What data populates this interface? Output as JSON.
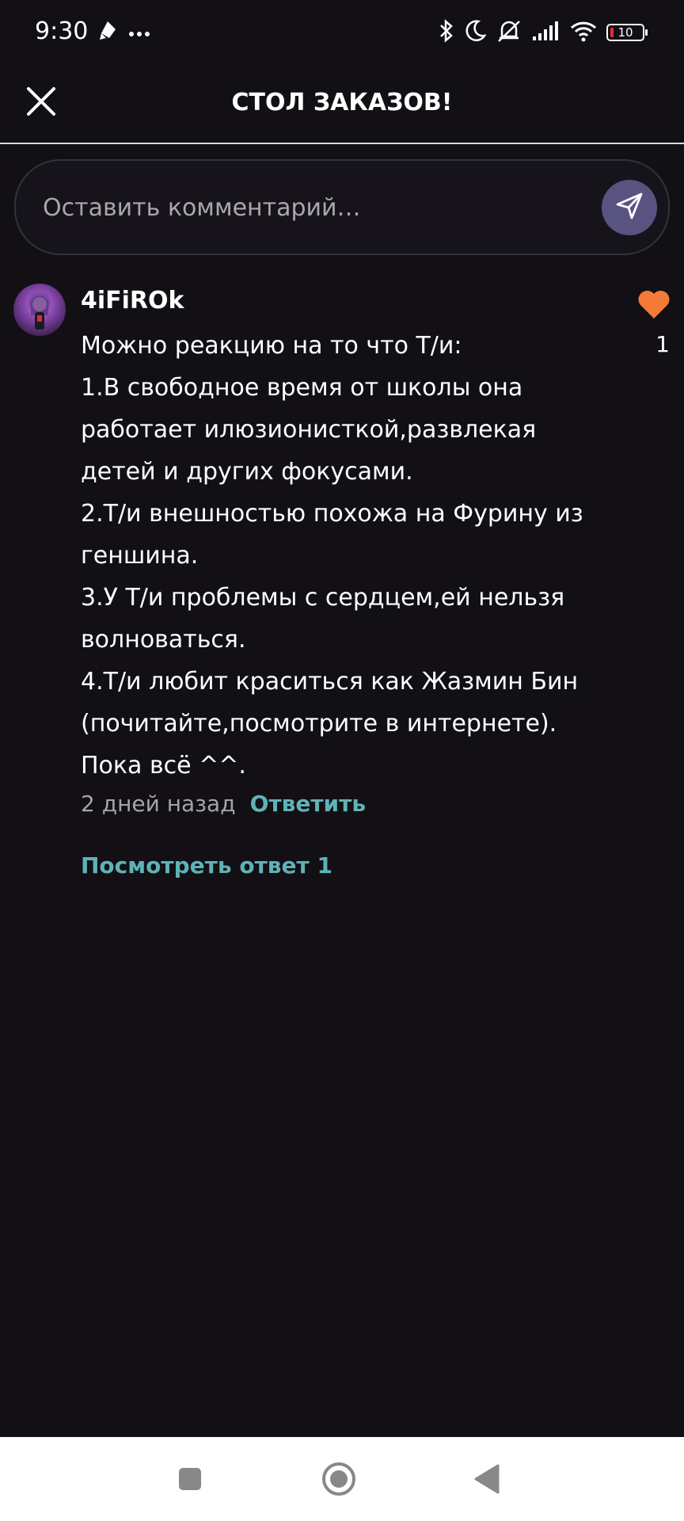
{
  "status_bar": {
    "time": "9:30",
    "battery_level": "10",
    "battery_color": "#e0302c",
    "left_icons": [
      "pen-nib-icon",
      "more-dots-icon"
    ],
    "right_icons": [
      "bluetooth-icon",
      "moon-icon",
      "muted-bell-icon",
      "signal-icon",
      "wifi-icon",
      "battery-icon"
    ]
  },
  "header": {
    "title": "СТОЛ ЗАКАЗОВ!",
    "close_icon": "close-icon"
  },
  "composer": {
    "placeholder": "Оставить комментарий…",
    "send_icon": "send-icon",
    "send_color": "#595382"
  },
  "comment": {
    "username": "4iFiROk",
    "lines": [
      "Можно реакцию на то что Т/и:",
      "1.В свободное время от школы она",
      "работает илюзионисткой,развлекая",
      "детей и других фокусами.",
      "2.Т/и внешностью похожа на Фурину из",
      "геншина.",
      "3.У Т/и проблемы с сердцем,ей нельзя",
      "волноваться.",
      "4.Т/и любит краситься как Жазмин Бин",
      "(почитайте,посмотрите в интернете).",
      "Пока всё ^^."
    ],
    "likes": "1",
    "like_color": "#f47a37",
    "time_ago": "2 дней назад",
    "reply_label": "Ответить",
    "view_replies_label": "Посмотреть ответ 1",
    "accent_color": "#5fb2b7"
  },
  "nav_bar": {
    "buttons": [
      "recents-square-icon",
      "home-circle-icon",
      "back-triangle-icon"
    ]
  }
}
